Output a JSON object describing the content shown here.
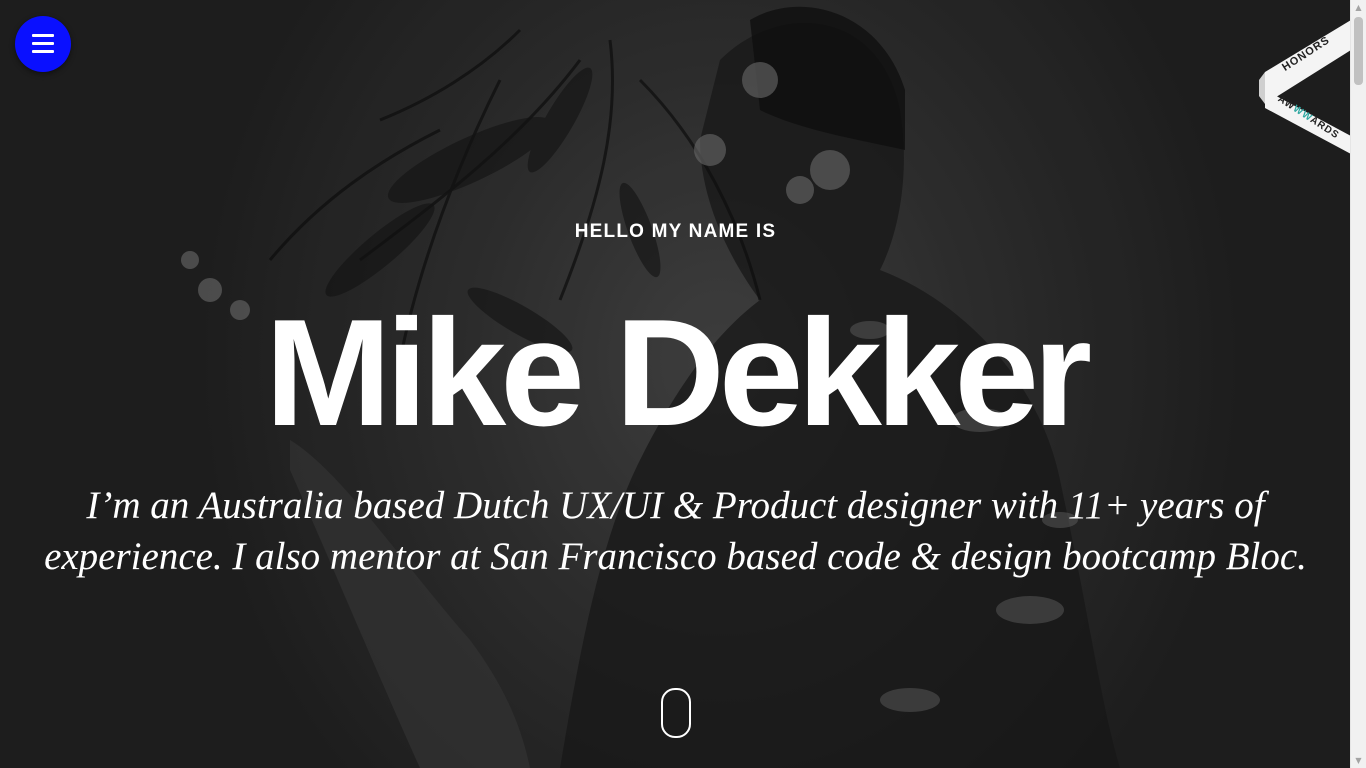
{
  "menu": {
    "icon": "hamburger-menu-icon",
    "color": "#0a10ff"
  },
  "award": {
    "honors_label": "HONORS",
    "brand_prefix": "AW",
    "brand_mid": "WW",
    "brand_suffix": "ARDS"
  },
  "hero": {
    "eyebrow": "HELLO MY NAME IS",
    "name": "Mike Dekker",
    "bio": "I’m an Australia based Dutch UX/UI & Product designer with 11+ years of experience. I also mentor at San Francisco based code & design bootcamp Bloc."
  },
  "scroll": {
    "icon": "mouse-scroll-icon"
  },
  "colors": {
    "accent": "#0a10ff",
    "text": "#ffffff",
    "background": "#2d2d2d",
    "awwwards_teal": "#2ea7a1"
  }
}
